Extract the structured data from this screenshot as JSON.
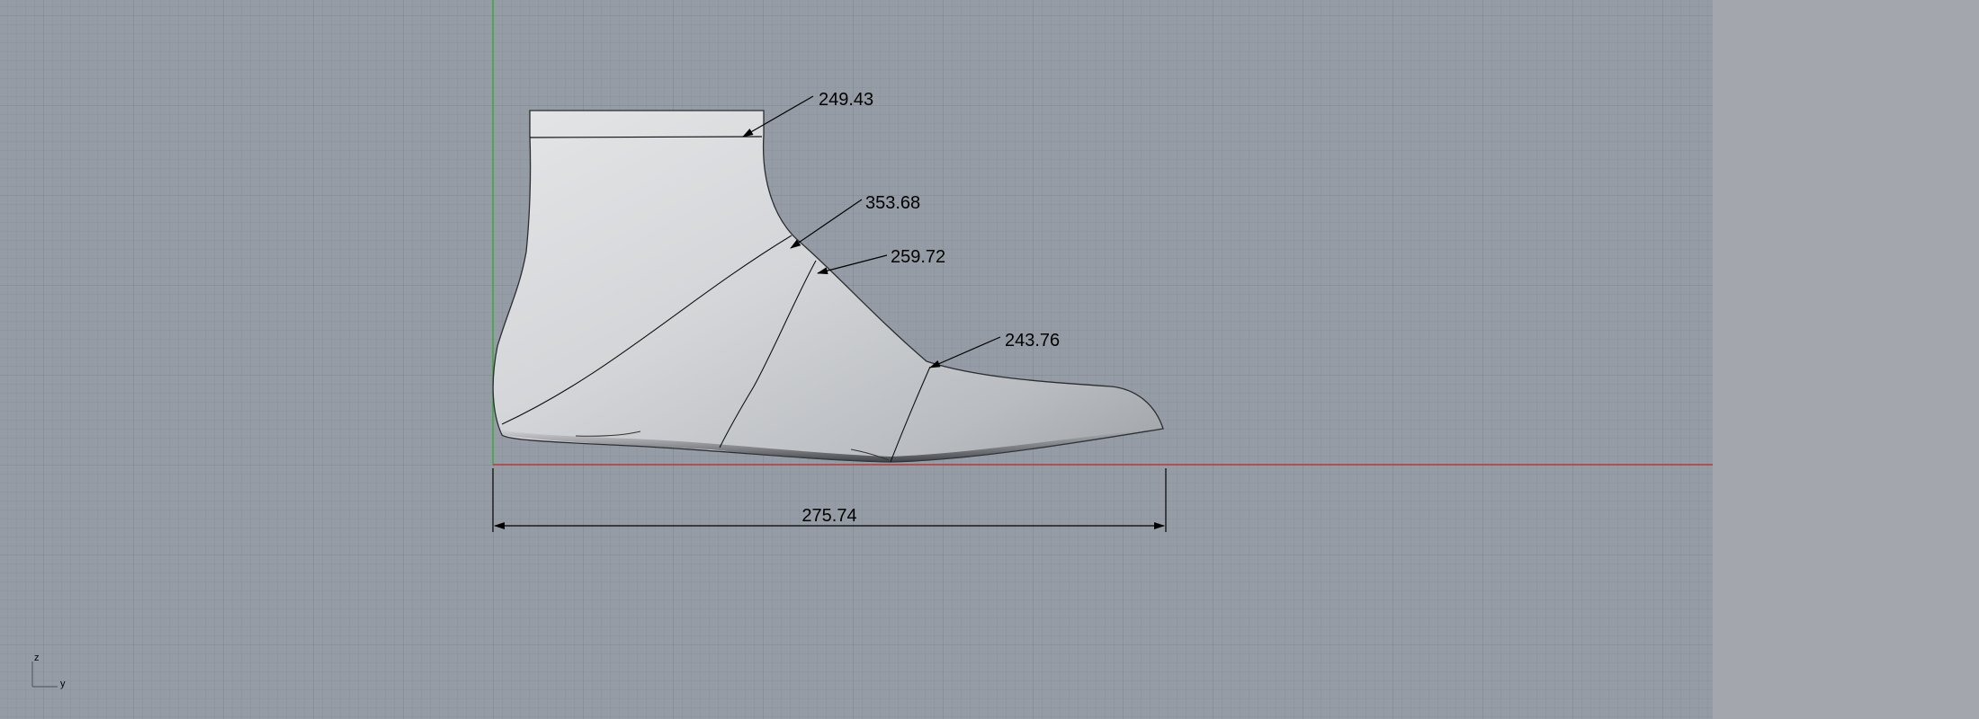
{
  "viewport": {
    "name": "Right",
    "background_color": "#969ca5",
    "grid_minor_color": "#8c929b",
    "grid_major_color": "#7f858e",
    "axis_x_color": "#b33a3a",
    "axis_z_color": "#3aaa3a"
  },
  "dimensions": {
    "length": "275.74",
    "top_girth": "249.43",
    "instep_girth": "353.68",
    "waist_girth": "259.72",
    "ball_girth": "243.76"
  },
  "axis_triad": {
    "vertical_label": "z",
    "horizontal_label": "y"
  }
}
